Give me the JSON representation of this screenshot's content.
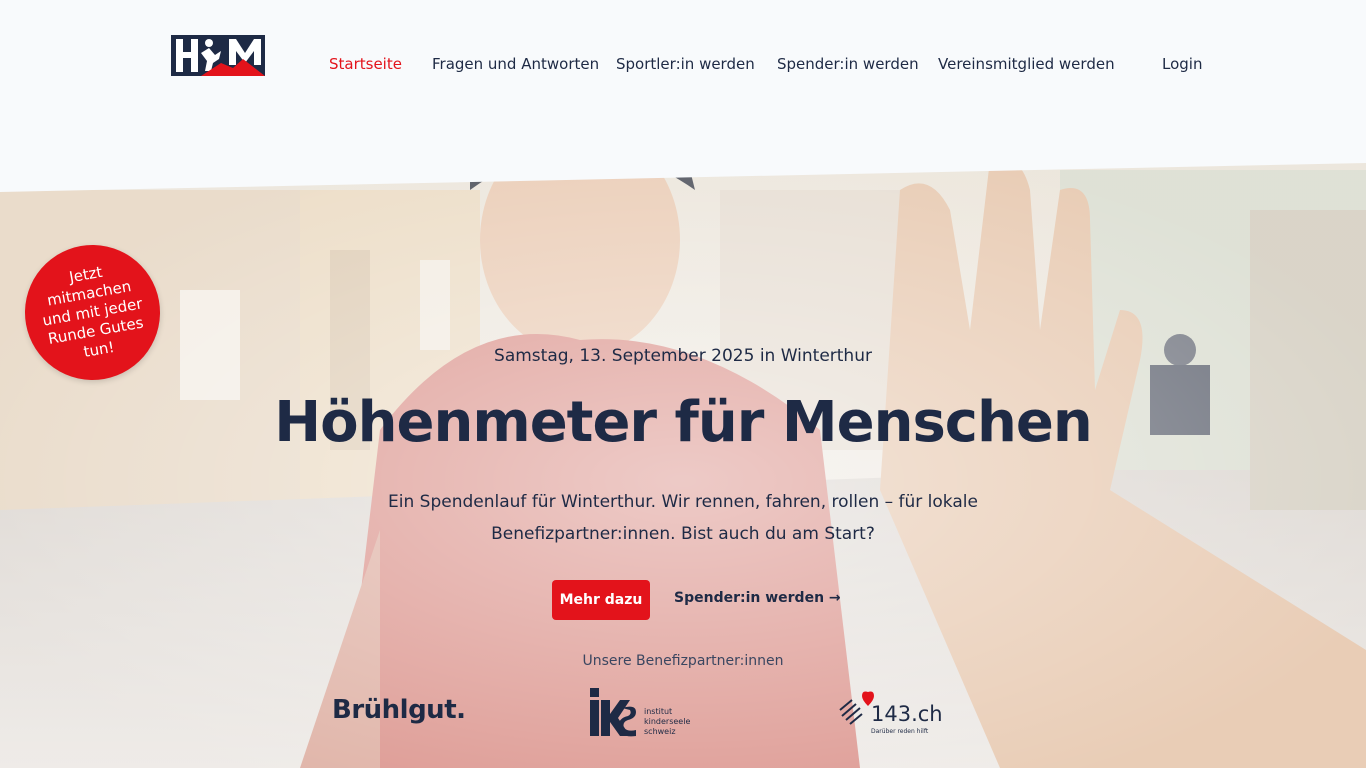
{
  "header": {
    "logo_alt": "HFM",
    "nav": [
      {
        "label": "Startseite",
        "active": true
      },
      {
        "label": "Fragen und Antworten",
        "active": false
      },
      {
        "label": "Sportler:in werden",
        "active": false
      },
      {
        "label": "Spender:in werden",
        "active": false
      },
      {
        "label": "Vereinsmitglied werden",
        "active": false
      }
    ],
    "login_label": "Login"
  },
  "hero": {
    "badge_text": "Jetzt mitmachen und mit jeder Runde Gutes tun!",
    "date": "Samstag, 13. September 2025 in Winterthur",
    "title": "Höhenmeter für Menschen",
    "description": "Ein Spendenlauf für Winterthur. Wir rennen, fahren, rollen – für lokale Benefizpartner:innen. Bist auch du am Start?",
    "primary_button": "Mehr dazu",
    "secondary_link": "Spender:in werden →"
  },
  "partners": {
    "label": "Unsere Benefizpartner:innen",
    "bruehlgut": "Brühlgut.",
    "iks_lines": [
      "institut",
      "kinderseele",
      "schweiz"
    ],
    "p143_name": "143.ch",
    "p143_tagline": "Darüber reden hilft"
  },
  "colors": {
    "accent": "#e3131b",
    "navy": "#1e2a45",
    "background": "#f8fafc"
  }
}
